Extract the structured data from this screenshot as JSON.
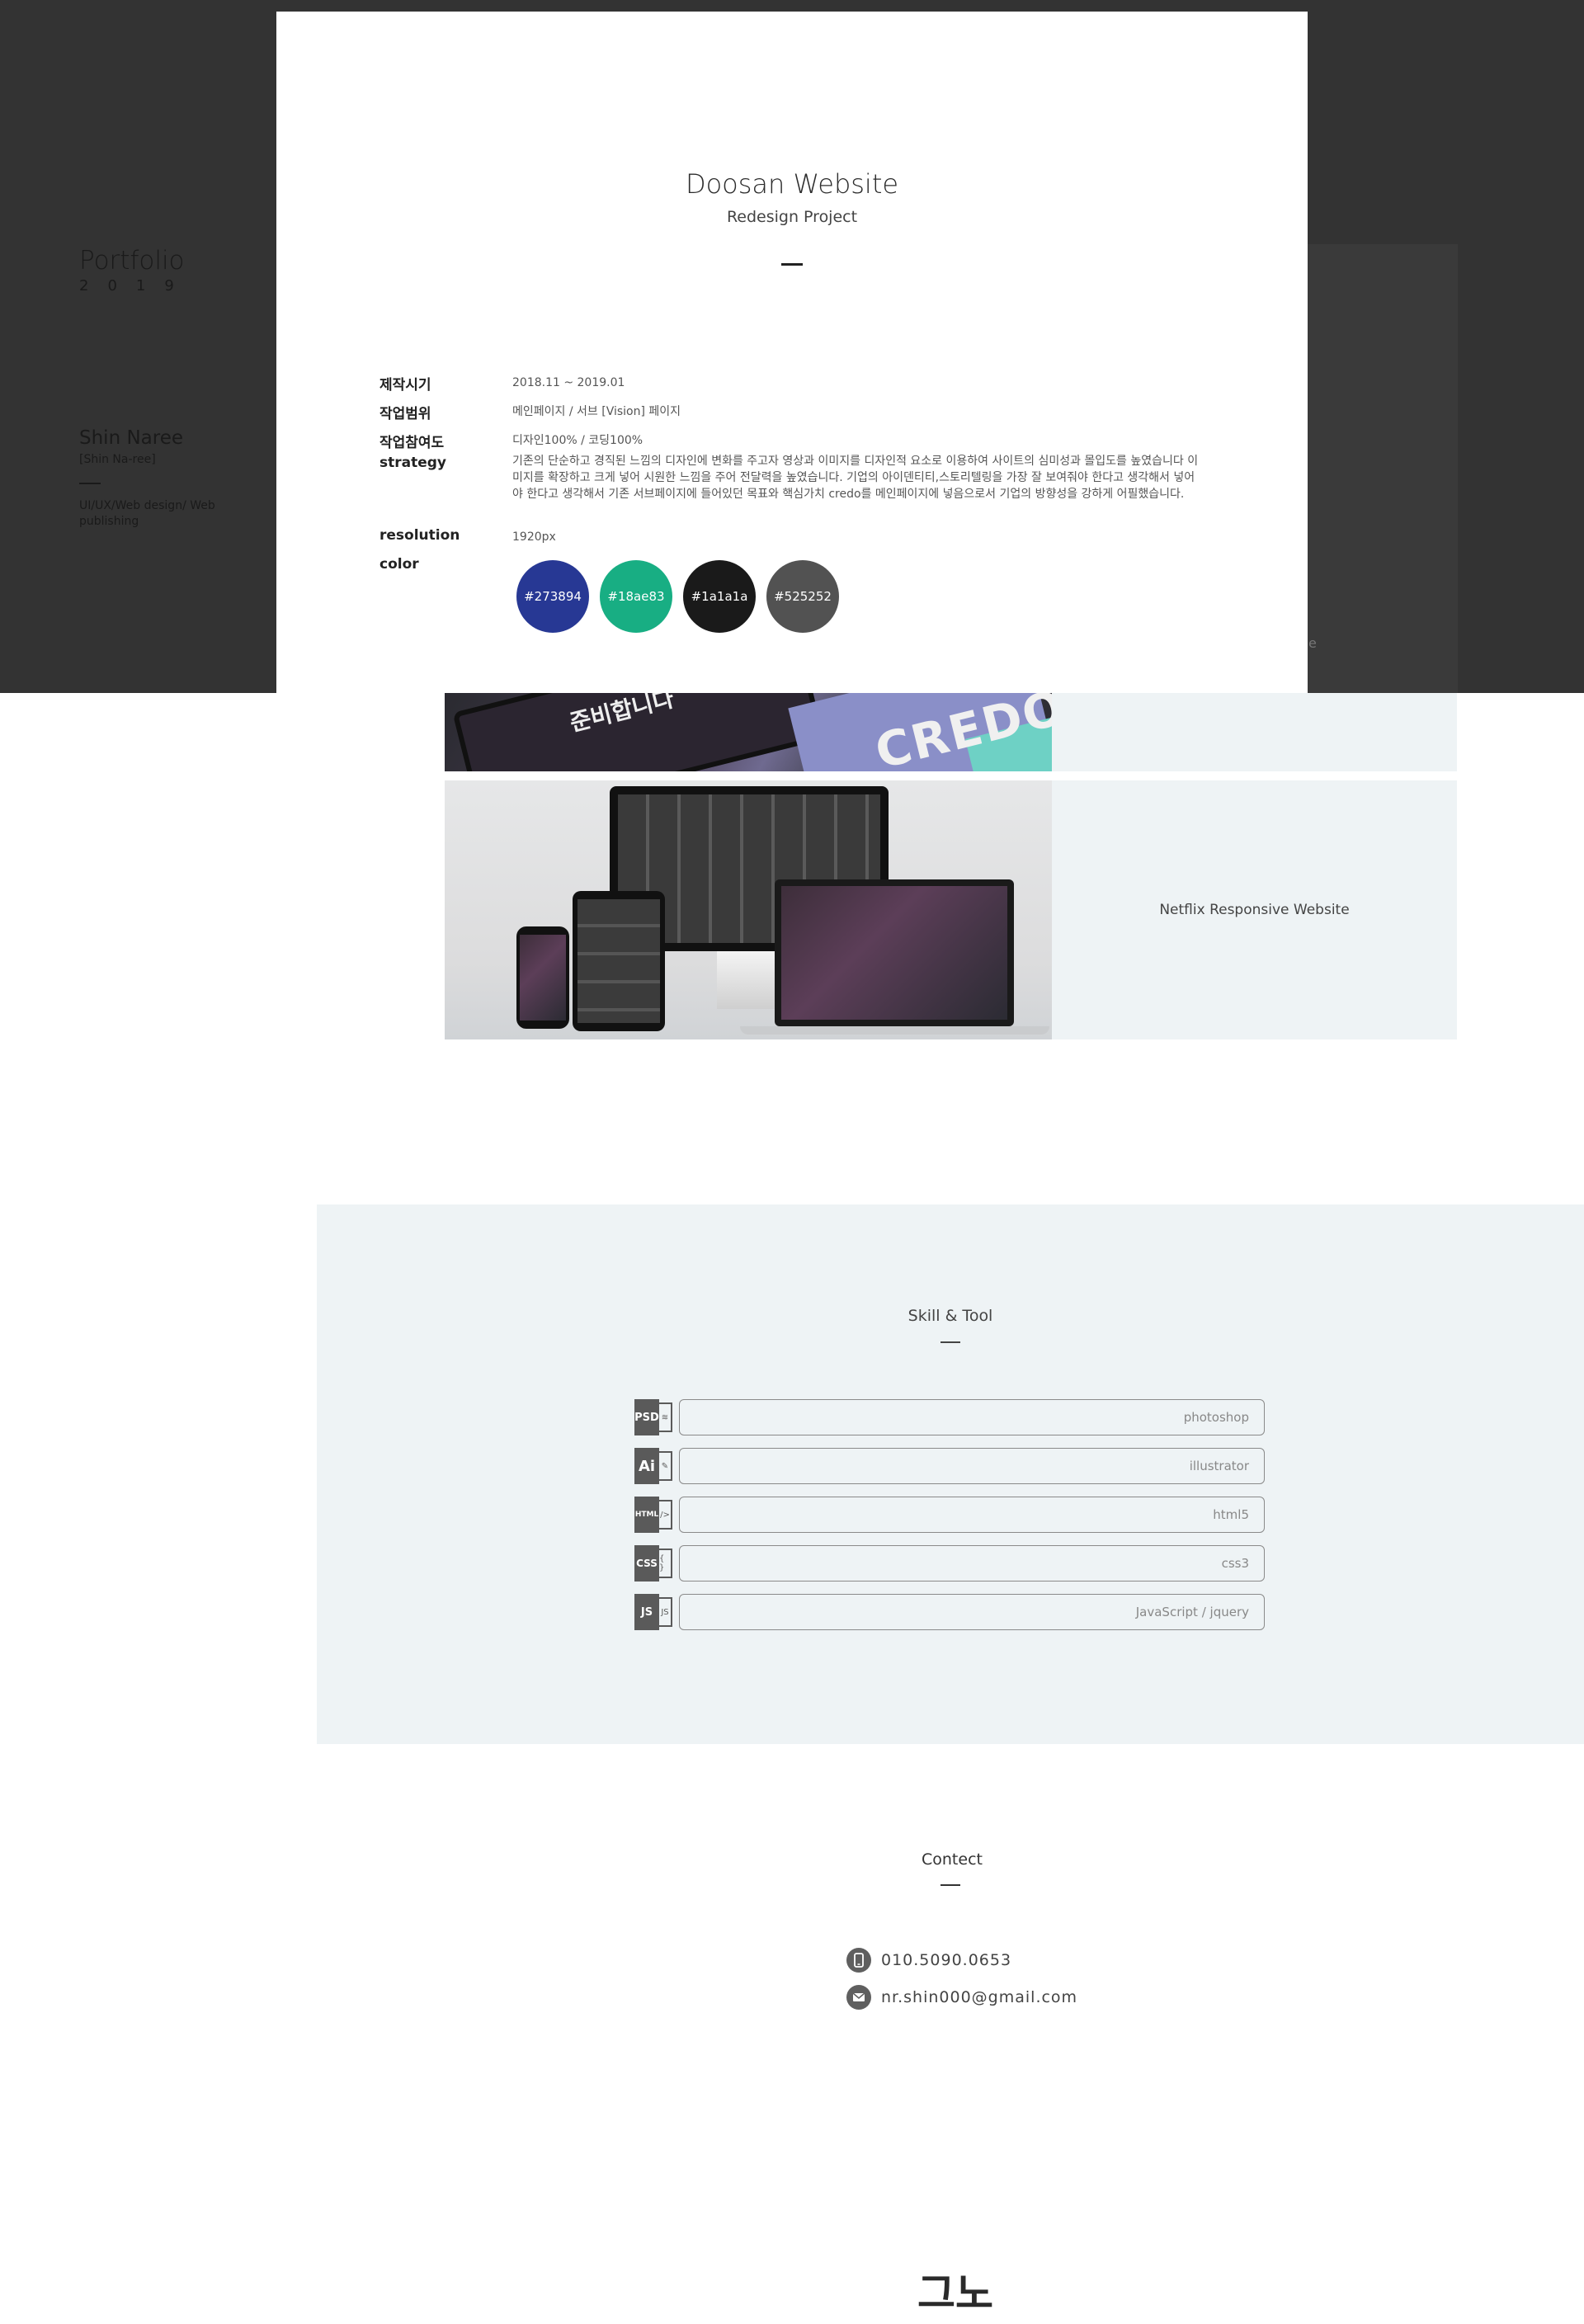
{
  "sidebar": {
    "portfolio": "Portfolio",
    "year": "2019",
    "name": "Shin Naree",
    "name_sub": "[Shin Na-ree]",
    "role": "UI/UX/Web design/ Web publishing"
  },
  "modal": {
    "title": "Doosan Website",
    "subtitle": "Redesign Project",
    "rows": [
      {
        "label": "제작시기",
        "value": "2018.11 ~ 2019.01"
      },
      {
        "label": "작업범위",
        "value": "메인페이지 / 서브 [Vision] 페이지"
      },
      {
        "label": "작업참여도",
        "value": "디자인100% / 코딩100%"
      },
      {
        "label": "strategy",
        "value": "기존의 단순하고 경직된 느낌의 디자인에 변화를 주고자 영상과 이미지를 디자인적 요소로 이용하여 사이트의 심미성과 몰입도를 높였습니다 이미지를 확장하고 크게 넣어 시원한 느낌을 주어 전달력을 높였습니다. 기업의 아이덴티티,스토리텔링을 가장 잘 보여줘야 한다고 생각해서 넣어야 한다고 생각해서 기존 서브페이지에 들어있던 목표와 핵심가치 credo를 메인페이지에 넣음으로서 기업의 방향성을 강하게 어필했습니다."
      },
      {
        "label": "resolution",
        "value": "1920px"
      },
      {
        "label": "color",
        "value": ""
      }
    ],
    "colors": [
      "#273894",
      "#18ae83",
      "#1a1a1a",
      "#525252"
    ]
  },
  "gallery": {
    "item1_kor": "준비합니다",
    "item1_credo": "CREDO",
    "item2_title": "Netflix Responsive Website"
  },
  "skills": {
    "title": "Skill & Tool",
    "items": [
      {
        "badge": "PSD",
        "name": "photoshop"
      },
      {
        "badge": "Ai",
        "name": "illustrator"
      },
      {
        "badge": "HTML",
        "name": "html5"
      },
      {
        "badge": "CSS",
        "name": "css3"
      },
      {
        "badge": "JS",
        "name": "JavaScript / jquery"
      }
    ]
  },
  "contact": {
    "title": "Contect",
    "phone": "010.5090.0653",
    "email": "nr.shin000@gmail.com"
  },
  "footer": {
    "glyph": "그노"
  }
}
